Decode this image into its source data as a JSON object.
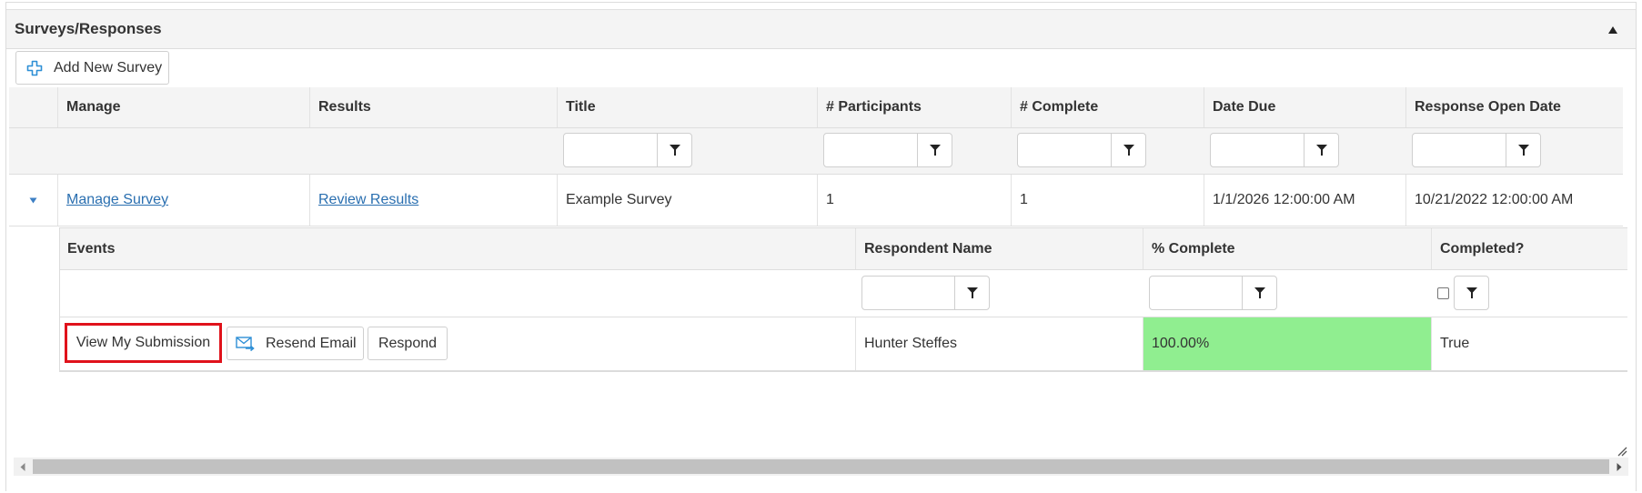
{
  "panel": {
    "title": "Surveys/Responses",
    "collapse_icon": "triangle-up-icon"
  },
  "toolbar": {
    "add_survey_label": "Add New Survey",
    "add_survey_icon": "plus-outline-icon"
  },
  "main_grid": {
    "columns": [
      "Manage",
      "Results",
      "Title",
      "# Participants",
      "# Complete",
      "Date Due",
      "Response Open Date"
    ],
    "filters": {
      "title": "",
      "participants": "",
      "complete": "",
      "date_due": "",
      "response_open_date": ""
    },
    "rows": [
      {
        "expanded": true,
        "manage_link": "Manage Survey",
        "results_link": "Review Results",
        "title": "Example Survey",
        "participants": "1",
        "complete": "1",
        "date_due": "1/1/2026 12:00:00 AM",
        "response_open_date": "10/21/2022 12:00:00 AM"
      }
    ]
  },
  "detail_grid": {
    "columns": [
      "Events",
      "Respondent Name",
      "% Complete",
      "Completed?"
    ],
    "filters": {
      "respondent_name": "",
      "percent_complete": "",
      "completed_checked": false
    },
    "rows": [
      {
        "events": {
          "view_submission_label": "View My Submission",
          "resend_email_label": "Resend Email",
          "resend_email_icon": "envelope-forward-icon",
          "respond_label": "Respond"
        },
        "respondent_name": "Hunter Steffes",
        "percent_complete": "100.00%",
        "percent_complete_bg": "#90ee90",
        "completed": "True"
      }
    ]
  },
  "colors": {
    "link": "#2a6fb0",
    "highlight_border": "#e0121b",
    "complete_green": "#90ee90",
    "icon_blue": "#2e8fd6"
  }
}
